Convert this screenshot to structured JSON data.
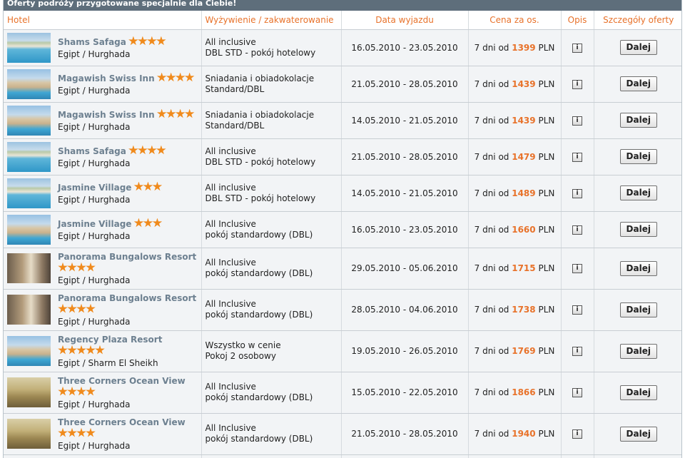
{
  "section_title": "Oferty podróży przygotowane specjalnie dla Ciebie!",
  "columns": {
    "hotel": "Hotel",
    "board": "Wyżywienie / zakwaterowanie",
    "date": "Data wyjazdu",
    "price": "Cena za os.",
    "info": "Opis",
    "details": "Szczegóły oferty"
  },
  "info_icon_glyph": "i",
  "button_label": "Dalej",
  "price_prefix": "7 dni od",
  "currency": "PLN",
  "colors": {
    "accent": "#e8722a",
    "header_bar": "#5e6e7b",
    "hotel_name": "#6d8090",
    "star": "#f08a1c"
  },
  "offers": [
    {
      "name": "Shams Safaga",
      "stars": 4,
      "dest": "Egipt / Hurghada",
      "board1": "All inclusive",
      "board2": "DBL STD - pokój hotelowy",
      "dates": "16.05.2010 - 23.05.2010",
      "price": "1399"
    },
    {
      "name": "Magawish Swiss Inn",
      "stars": 4,
      "dest": "Egipt / Hurghada",
      "board1": "Sniadania i obiadokolacje",
      "board2": "Standard/DBL",
      "dates": "21.05.2010 - 28.05.2010",
      "price": "1439"
    },
    {
      "name": "Magawish Swiss Inn",
      "stars": 4,
      "dest": "Egipt / Hurghada",
      "board1": "Sniadania i obiadokolacje",
      "board2": "Standard/DBL",
      "dates": "14.05.2010 - 21.05.2010",
      "price": "1439"
    },
    {
      "name": "Shams Safaga",
      "stars": 4,
      "dest": "Egipt / Hurghada",
      "board1": "All inclusive",
      "board2": "DBL STD - pokój hotelowy",
      "dates": "21.05.2010 - 28.05.2010",
      "price": "1479"
    },
    {
      "name": "Jasmine Village",
      "stars": 3,
      "dest": "Egipt / Hurghada",
      "board1": "All inclusive",
      "board2": "DBL STD - pokój hotelowy",
      "dates": "14.05.2010 - 21.05.2010",
      "price": "1489"
    },
    {
      "name": "Jasmine Village",
      "stars": 3,
      "dest": "Egipt / Hurghada",
      "board1": "All Inclusive",
      "board2": "pokój standardowy (DBL)",
      "dates": "16.05.2010 - 23.05.2010",
      "price": "1660"
    },
    {
      "name": "Panorama Bungalows Resort",
      "stars": 4,
      "dest": "Egipt / Hurghada",
      "board1": "All Inclusive",
      "board2": "pokój standardowy (DBL)",
      "dates": "29.05.2010 - 05.06.2010",
      "price": "1715"
    },
    {
      "name": "Panorama Bungalows Resort",
      "stars": 4,
      "dest": "Egipt / Hurghada",
      "board1": "All Inclusive",
      "board2": "pokój standardowy (DBL)",
      "dates": "28.05.2010 - 04.06.2010",
      "price": "1738"
    },
    {
      "name": "Regency Plaza Resort",
      "stars": 5,
      "dest": "Egipt / Sharm El Sheikh",
      "board1": "Wszystko w cenie",
      "board2": "Pokoj 2 osobowy",
      "dates": "19.05.2010 - 26.05.2010",
      "price": "1769"
    },
    {
      "name": "Three Corners Ocean View",
      "stars": 4,
      "dest": "Egipt / Hurghada",
      "board1": "All Inclusive",
      "board2": "pokój standardowy (DBL)",
      "dates": "15.05.2010 - 22.05.2010",
      "price": "1866"
    },
    {
      "name": "Three Corners Ocean View",
      "stars": 4,
      "dest": "Egipt / Hurghada",
      "board1": "All Inclusive",
      "board2": "pokój standardowy (DBL)",
      "dates": "21.05.2010 - 28.05.2010",
      "price": "1940"
    }
  ]
}
